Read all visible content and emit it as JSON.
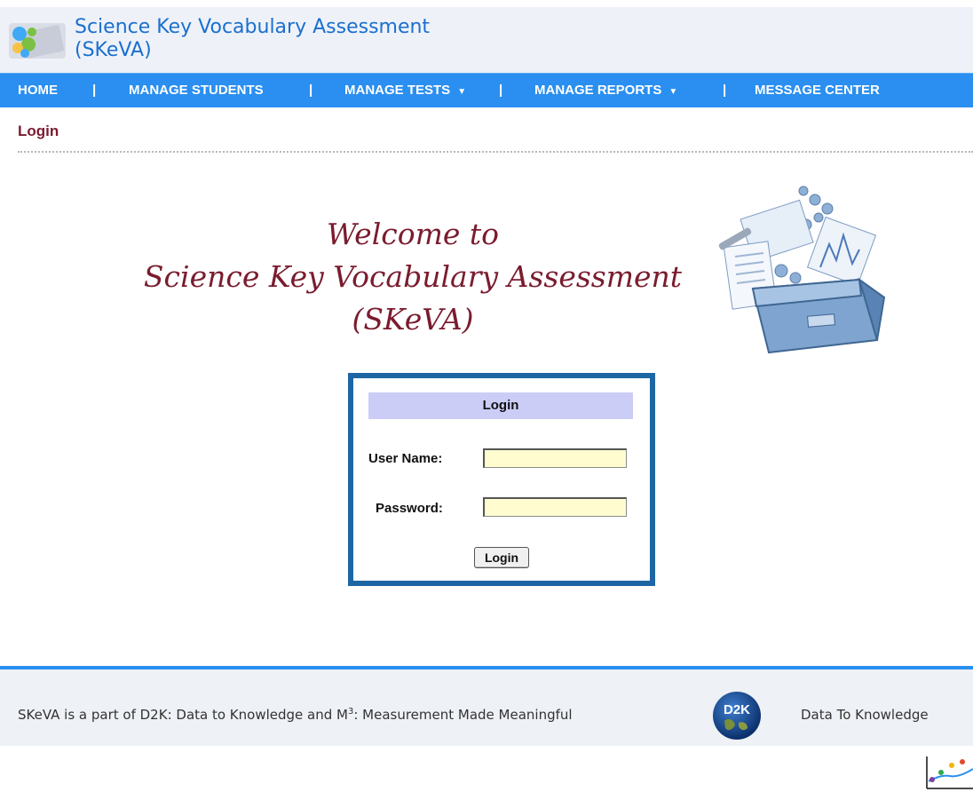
{
  "header": {
    "title_line1": "Science Key Vocabulary Assessment",
    "title_line2": "(SKeVA)",
    "logo_icon": "puzzle-pieces-icon"
  },
  "nav": {
    "items": [
      {
        "label": "HOME"
      },
      {
        "label": "MANAGE STUDENTS"
      },
      {
        "label": "MANAGE TESTS",
        "caret": "▼"
      },
      {
        "label": "MANAGE REPORTS",
        "caret": "▼"
      },
      {
        "label": "MESSAGE CENTER"
      }
    ],
    "separator": "|"
  },
  "page": {
    "heading": "Login"
  },
  "welcome": {
    "line1": "Welcome to",
    "line2": "Science Key Vocabulary Assessment",
    "line3": "(SKeVA)",
    "illustration_icon": "science-toolbox-icon"
  },
  "login": {
    "title": "Login",
    "username_label": "User Name:",
    "username_value": "",
    "password_label": "Password:",
    "password_value": "",
    "submit_label": "Login"
  },
  "footer": {
    "text_pre": "SKeVA is a part of D2K: Data to Knowledge and M",
    "text_sup": "3",
    "text_post": ": Measurement Made Meaningful",
    "d2k_logo_text": "D2K",
    "d2k_caption": "Data To Knowledge"
  },
  "colors": {
    "nav": "#2a8ff0",
    "title": "#1b6fcf",
    "heading": "#7a1c2e",
    "login_border": "#1e66a3",
    "login_header": "#cccdf7",
    "input_bg": "#fffdd0"
  }
}
